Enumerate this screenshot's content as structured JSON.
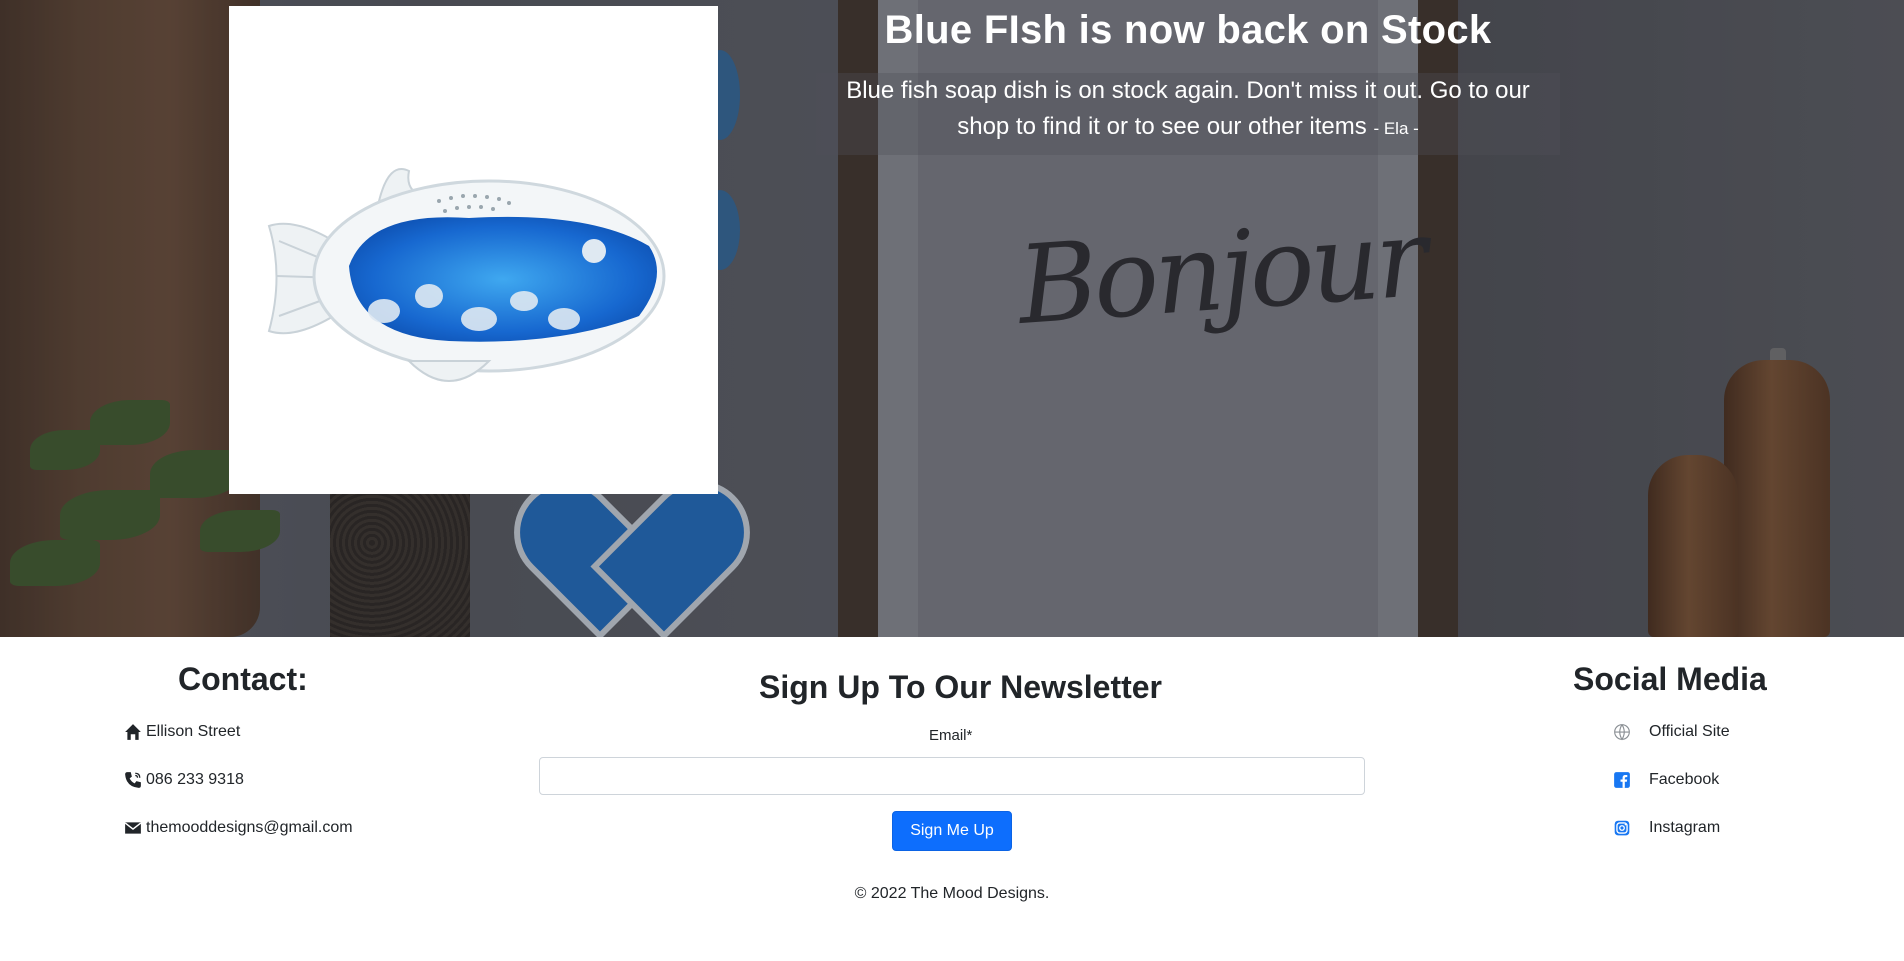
{
  "hero": {
    "title": "Blue FIsh is now back on Stock",
    "body": "Blue fish soap dish is on stock again. Don't miss it out. Go to our shop to find it or to see our other items",
    "signature": "- Ela -",
    "background_sign_text": "Bonjour"
  },
  "contact": {
    "title": "Contact:",
    "items": [
      {
        "icon": "home-icon",
        "text": "Ellison Street"
      },
      {
        "icon": "phone-icon",
        "text": "086 233 9318"
      },
      {
        "icon": "envelope-icon",
        "text": "themooddesigns@gmail.com"
      }
    ]
  },
  "newsletter": {
    "title": "Sign Up To Our Newsletter",
    "email_label": "Email*",
    "email_value": "",
    "button_label": "Sign Me Up"
  },
  "social": {
    "title": "Social Media",
    "items": [
      {
        "icon": "globe-icon",
        "text": "Official Site"
      },
      {
        "icon": "facebook-icon",
        "text": "Facebook"
      },
      {
        "icon": "instagram-icon",
        "text": "Instagram"
      }
    ]
  },
  "copyright": "© 2022 The Mood Designs.",
  "colors": {
    "accent": "#0d6efd",
    "hero_text": "#ffffff",
    "text": "#212529",
    "fish_blue": "#1a6fd6"
  }
}
